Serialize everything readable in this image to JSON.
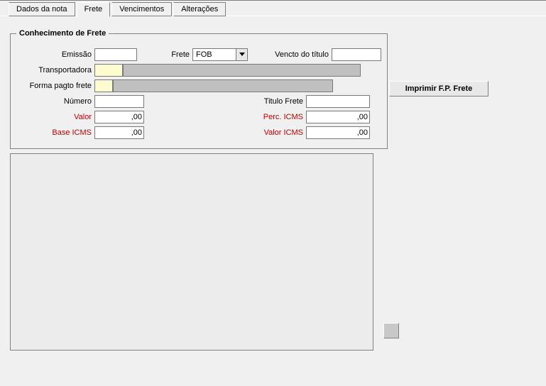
{
  "tabs": {
    "dados": "Dados da nota",
    "frete": "Frete",
    "venc": "Vencimentos",
    "alt": "Alterações"
  },
  "group": {
    "title": "Conhecimento de Frete"
  },
  "labels": {
    "emissao": "Emissão",
    "frete": "Frete",
    "vencto": "Vencto do título",
    "transportadora": "Transportadora",
    "forma": "Forma pagto frete",
    "numero": "Número",
    "titulo": "Titulo Frete",
    "valor": "Valor",
    "percicms": "Perc. ICMS",
    "baseicms": "Base ICMS",
    "valoricms": "Valor ICMS"
  },
  "values": {
    "emissao": "",
    "frete_sel": "FOB",
    "vencto": "",
    "transportadora_code": "",
    "transportadora_name": "",
    "forma_code": "",
    "forma_name": "",
    "numero": "",
    "titulo": "",
    "valor": ",00",
    "percicms": ",00",
    "baseicms": ",00",
    "valoricms": ",00"
  },
  "buttons": {
    "print": "Imprimir F.P. Frete"
  }
}
